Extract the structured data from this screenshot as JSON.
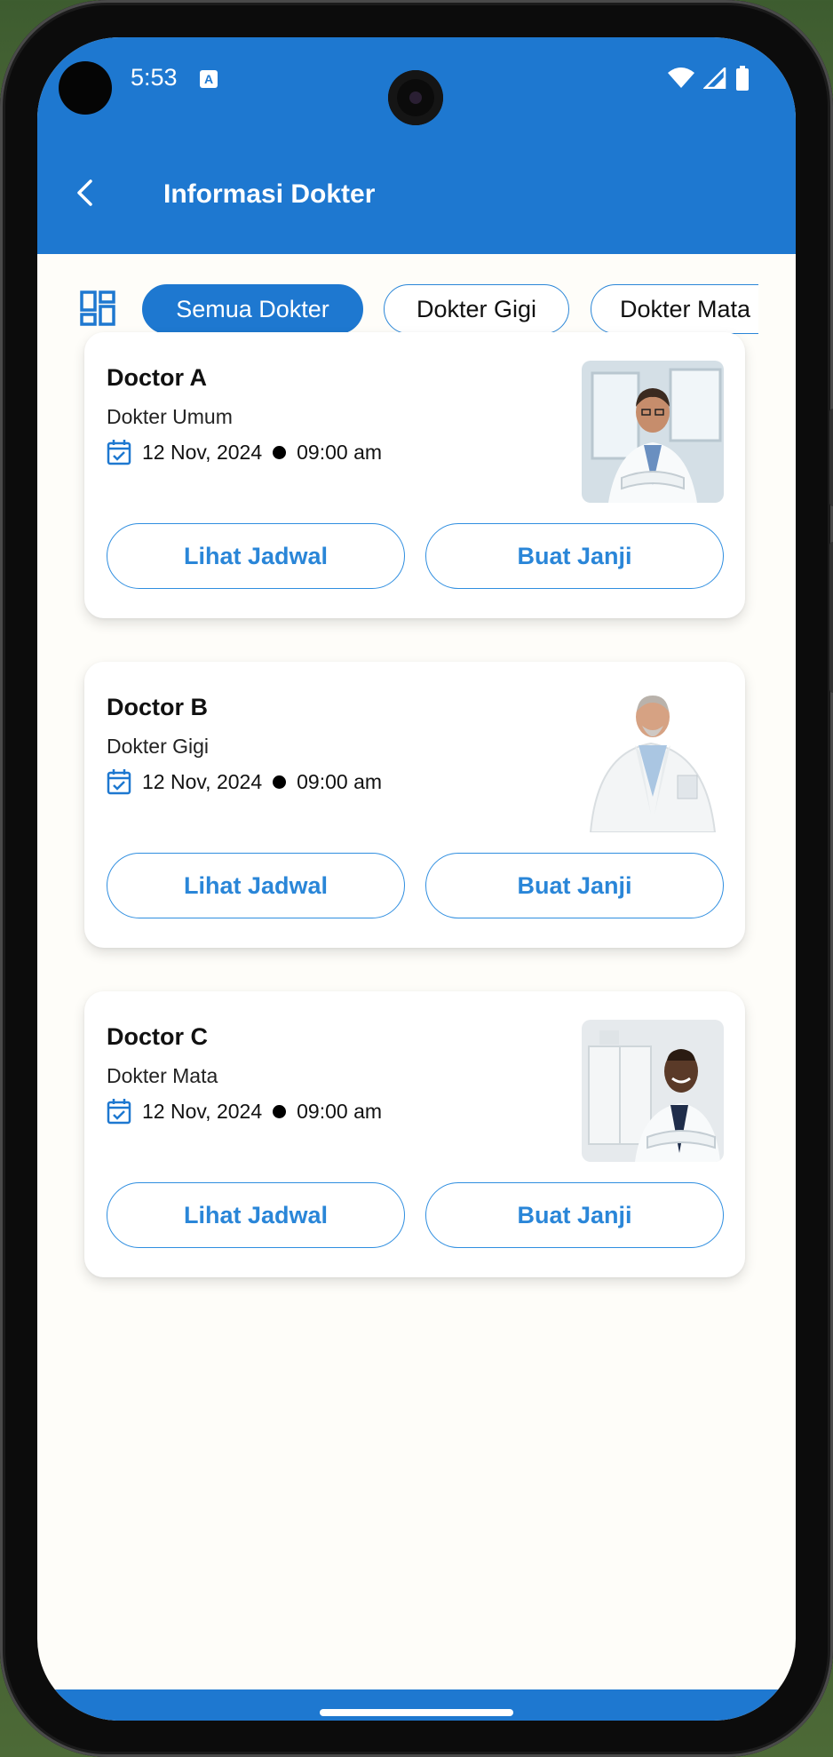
{
  "status_bar": {
    "time": "5:53",
    "notification_icon": "a-icon",
    "icons": [
      "wifi-icon",
      "signal-icon",
      "battery-icon"
    ]
  },
  "app_bar": {
    "title": "Informasi Dokter",
    "back_icon": "chevron-left-icon"
  },
  "filters": {
    "layout_icon": "dashboard-grid-icon",
    "chips": [
      {
        "label": "Semua Dokter",
        "active": true
      },
      {
        "label": "Dokter Gigi",
        "active": false
      },
      {
        "label": "Dokter Mata",
        "active": false
      }
    ]
  },
  "doctors": [
    {
      "name": "Doctor A",
      "specialty": "Dokter Umum",
      "date": "12 Nov, 2024",
      "time": "09:00 am",
      "schedule_button": "Lihat Jadwal",
      "appointment_button": "Buat Janji"
    },
    {
      "name": "Doctor B",
      "specialty": "Dokter Gigi",
      "date": "12 Nov, 2024",
      "time": "09:00 am",
      "schedule_button": "Lihat Jadwal",
      "appointment_button": "Buat Janji"
    },
    {
      "name": "Doctor C",
      "specialty": "Dokter Mata",
      "date": "12 Nov, 2024",
      "time": "09:00 am",
      "schedule_button": "Lihat Jadwal",
      "appointment_button": "Buat Janji"
    }
  ],
  "colors": {
    "primary": "#1e78d0",
    "button_text": "#2a86d8",
    "background": "#fefdf9"
  }
}
